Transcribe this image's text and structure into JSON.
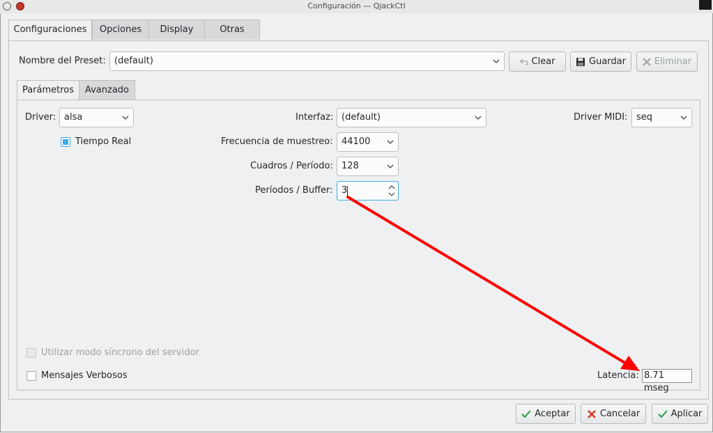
{
  "window": {
    "title": "Configuración — QjackCtl"
  },
  "tabs": [
    "Configuraciones",
    "Opciones",
    "Display",
    "Otras"
  ],
  "preset": {
    "label": "Nombre del Preset:",
    "value": "(default)",
    "clear": "Clear",
    "save": "Guardar",
    "delete": "Eliminar"
  },
  "subtabs": [
    "Parámetros",
    "Avanzado"
  ],
  "params": {
    "driver_label": "Driver:",
    "driver_value": "alsa",
    "realtime_label": "Tiempo Real",
    "interface_label": "Interfaz:",
    "interface_value": "(default)",
    "midi_label": "Driver MIDI:",
    "midi_value": "seq",
    "samplerate_label": "Frecuencia de muestreo:",
    "samplerate_value": "44100",
    "frames_label": "Cuadros / Período:",
    "frames_value": "128",
    "periods_label": "Períodos / Buffer:",
    "periods_value": "3",
    "sync_label": "Utilizar modo síncrono del servidor",
    "verbose_label": "Mensajes Verbosos",
    "latency_label": "Latencia:",
    "latency_value": "8.71 mseg"
  },
  "buttons": {
    "accept": "Aceptar",
    "cancel": "Cancelar",
    "apply": "Aplicar"
  },
  "colors": {
    "accent": "#3daee9",
    "arrow": "#ff0000"
  }
}
